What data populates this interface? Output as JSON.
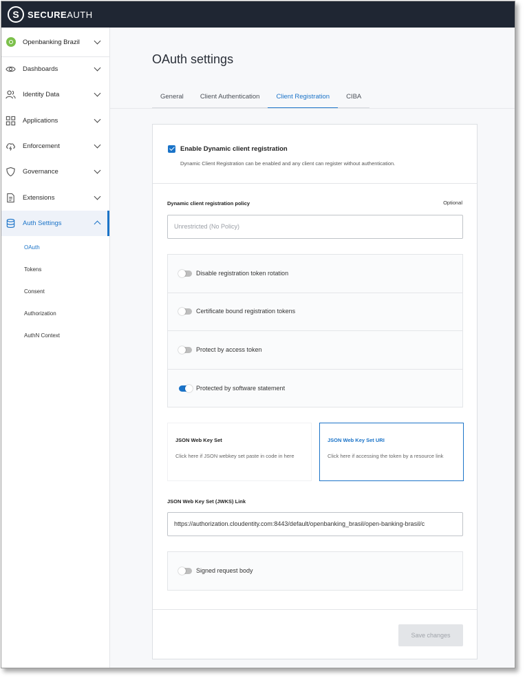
{
  "app": {
    "brand_bold": "SECURE",
    "brand_thin": "AUTH",
    "logo_glyph": "S"
  },
  "workspace": {
    "name": "Openbanking Brazil",
    "color": "#7cc04b"
  },
  "sidebar": {
    "items": [
      {
        "label": "Dashboards",
        "icon": "eye-icon"
      },
      {
        "label": "Identity Data",
        "icon": "users-icon"
      },
      {
        "label": "Applications",
        "icon": "grid-icon"
      },
      {
        "label": "Enforcement",
        "icon": "cloud-bolt-icon"
      },
      {
        "label": "Governance",
        "icon": "shield-icon"
      },
      {
        "label": "Extensions",
        "icon": "document-icon"
      },
      {
        "label": "Auth Settings",
        "icon": "database-icon",
        "active": true
      }
    ],
    "sub_items": [
      "OAuth",
      "Tokens",
      "Consent",
      "Authorization",
      "AuthN Context"
    ]
  },
  "main": {
    "title": "OAuth settings",
    "tabs": [
      "General",
      "Client Authentication",
      "Client Registration",
      "CIBA"
    ],
    "active_tab": "Client Registration"
  },
  "form": {
    "enable_dcr": {
      "label": "Enable Dynamic client registration",
      "checked": true,
      "description": "Dynamic Client Registration can be enabled and any client can register without authentication."
    },
    "policy": {
      "label": "Dynamic client registration policy",
      "optional": "Optional",
      "placeholder": "Unrestricted (No Policy)"
    },
    "toggles": [
      {
        "label": "Disable registration token rotation",
        "on": false
      },
      {
        "label": "Certificate bound registration tokens",
        "on": false
      },
      {
        "label": "Protect by access token",
        "on": false
      },
      {
        "label": "Protected by software statement",
        "on": true
      }
    ],
    "jwks_options": [
      {
        "title": "JSON Web Key Set",
        "description": "Click here if JSON webkey set paste in code in here",
        "selected": false
      },
      {
        "title": "JSON Web Key Set URI",
        "description": "Click here if accessing the token by a resource link",
        "selected": true
      }
    ],
    "jwks_link": {
      "label": "JSON Web Key Set (JWKS) Link",
      "value": "https://authorization.cloudentity.com:8443/default/openbanking_brasil/open-banking-brasil/c"
    },
    "signed_request": {
      "label": "Signed request body",
      "on": false
    },
    "save_label": "Save changes"
  },
  "colors": {
    "accent": "#1a73c8",
    "topbar": "#1f2633"
  }
}
